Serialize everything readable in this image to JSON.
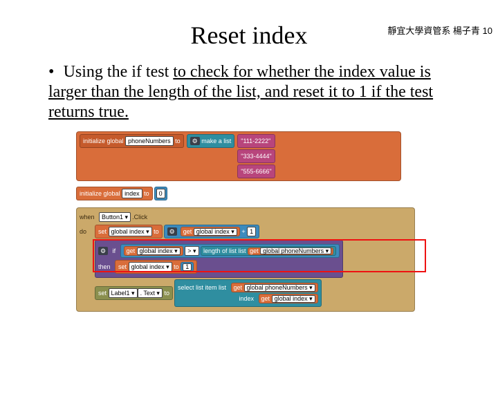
{
  "header": {
    "corner_text": "靜宜大學資管系 楊子青 10"
  },
  "title": "Reset index",
  "bullet": {
    "prefix": "Using the if test ",
    "underlined": "to check for whether the index value is larger than the length of the list, and reset it to 1 if the test returns true."
  },
  "blocks": {
    "init1": {
      "label": "initialize global",
      "var": "phoneNumbers",
      "to": "to",
      "makelist_icon": "⚙",
      "makelist": "make a list",
      "items": [
        "\"111-2222\"",
        "\"333-4444\"",
        "\"555-6666\""
      ]
    },
    "init2": {
      "label": "initialize global",
      "var": "index",
      "to": "to",
      "value": "0"
    },
    "event": {
      "when": "when",
      "component": "Button1 ▾",
      "evt": ".Click",
      "do": "do",
      "set1": {
        "set": "set",
        "var": "global index ▾",
        "to": "to",
        "gear": "⚙",
        "get": "get",
        "gvar": "global index ▾",
        "plus": "+",
        "one": "1"
      },
      "if": {
        "gear": "⚙",
        "if": "if",
        "get1": "get",
        "gvar1": "global index ▾",
        "op": "> ▾",
        "len": "length of list   list",
        "get2": "get",
        "gvar2": "global phoneNumbers ▾",
        "then": "then",
        "set": "set",
        "svar": "global index ▾",
        "sto": "to",
        "sval": "1"
      },
      "set2": {
        "set": "set",
        "comp": "Label1 ▾",
        "prop": ". Text ▾",
        "to": "to",
        "sel": "select list item   list",
        "get1": "get",
        "gvar1": "global phoneNumbers ▾",
        "idx": "index",
        "get2": "get",
        "gvar2": "global index ▾"
      }
    }
  }
}
